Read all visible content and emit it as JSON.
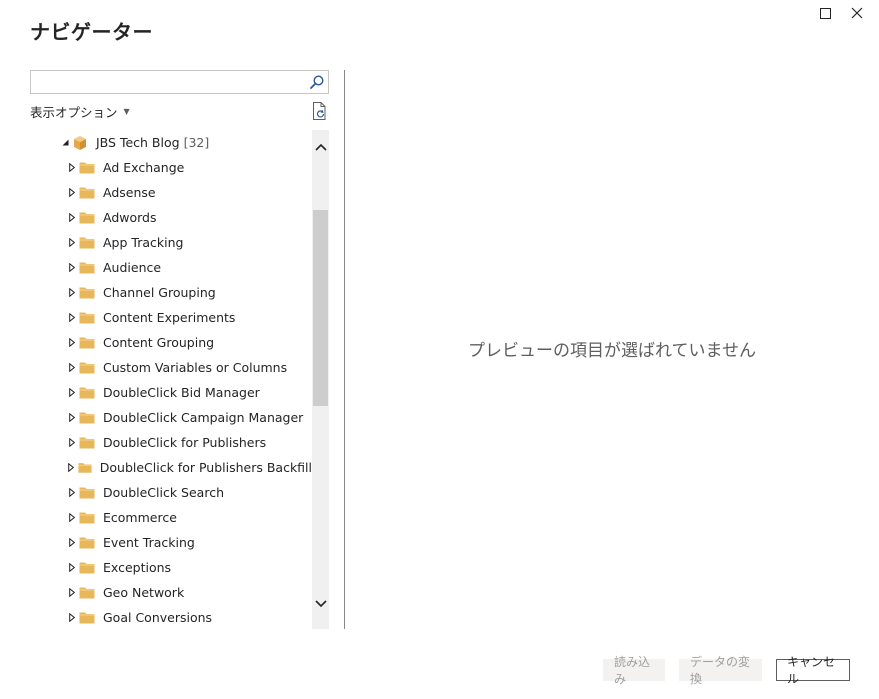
{
  "dialog": {
    "title": "ナビゲーター"
  },
  "search": {
    "value": "",
    "placeholder": ""
  },
  "display_options": {
    "label": "表示オプション"
  },
  "tree": {
    "root": {
      "label": "JBS Tech Blog",
      "count": "[32]"
    },
    "items": [
      {
        "label": "Ad Exchange"
      },
      {
        "label": "Adsense"
      },
      {
        "label": "Adwords"
      },
      {
        "label": "App Tracking"
      },
      {
        "label": "Audience"
      },
      {
        "label": "Channel Grouping"
      },
      {
        "label": "Content Experiments"
      },
      {
        "label": "Content Grouping"
      },
      {
        "label": "Custom Variables or Columns"
      },
      {
        "label": "DoubleClick Bid Manager"
      },
      {
        "label": "DoubleClick Campaign Manager"
      },
      {
        "label": "DoubleClick for Publishers"
      },
      {
        "label": "DoubleClick for Publishers Backfill"
      },
      {
        "label": "DoubleClick Search"
      },
      {
        "label": "Ecommerce"
      },
      {
        "label": "Event Tracking"
      },
      {
        "label": "Exceptions"
      },
      {
        "label": "Geo Network"
      },
      {
        "label": "Goal Conversions"
      }
    ]
  },
  "preview": {
    "empty_message": "プレビューの項目が選ばれていません"
  },
  "footer": {
    "load_label": "読み込み",
    "transform_label": "データの変換",
    "cancel_label": "キャンセル"
  },
  "colors": {
    "folder": "#e8b75a",
    "cube": "#e5a84a",
    "accent": "#2b579a"
  }
}
